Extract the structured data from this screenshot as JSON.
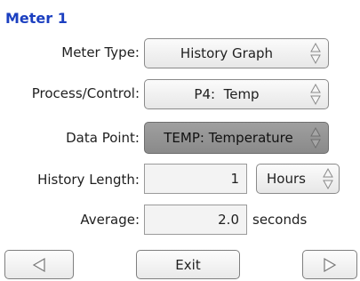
{
  "screen": {
    "title": "Meter 1"
  },
  "fields": {
    "meter_type": {
      "label": "Meter Type:",
      "value": "History Graph"
    },
    "process_control": {
      "label": "Process/Control:",
      "value": "P4:  Temp"
    },
    "data_point": {
      "label": "Data Point:",
      "value": "TEMP: Temperature"
    },
    "history_length": {
      "label": "History Length:",
      "value": "1",
      "unit": "Hours"
    },
    "average": {
      "label": "Average:",
      "value": "2.0",
      "unit": "seconds"
    }
  },
  "buttons": {
    "exit": "Exit"
  },
  "icons": {
    "prev": "triangle-left-icon",
    "next": "triangle-right-icon",
    "spinner": "up-down-spinner-icon"
  }
}
